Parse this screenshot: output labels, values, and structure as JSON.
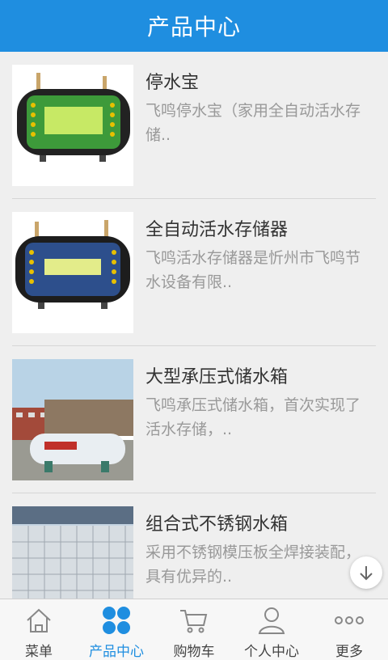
{
  "header": {
    "title": "产品中心"
  },
  "products": [
    {
      "title": "停水宝",
      "desc": "飞鸣停水宝（家用全自动活水存储.."
    },
    {
      "title": "全自动活水存储器",
      "desc": "飞鸣活水存储器是忻州市飞鸣节水设备有限.."
    },
    {
      "title": "大型承压式储水箱",
      "desc": "飞鸣承压式储水箱，首次实现了活水存储，.."
    },
    {
      "title": "组合式不锈钢水箱",
      "desc": "采用不锈钢模压板全焊接装配，具有优异的.."
    }
  ],
  "tabs": [
    {
      "label": "菜单",
      "icon": "home-icon"
    },
    {
      "label": "产品中心",
      "icon": "four-circles-icon"
    },
    {
      "label": "购物车",
      "icon": "cart-icon"
    },
    {
      "label": "个人中心",
      "icon": "person-icon"
    },
    {
      "label": "更多",
      "icon": "more-dots-icon"
    }
  ],
  "active_tab": "产品中心",
  "colors": {
    "accent": "#1f8ee0",
    "title_text": "#333333",
    "desc_text": "#999999"
  }
}
